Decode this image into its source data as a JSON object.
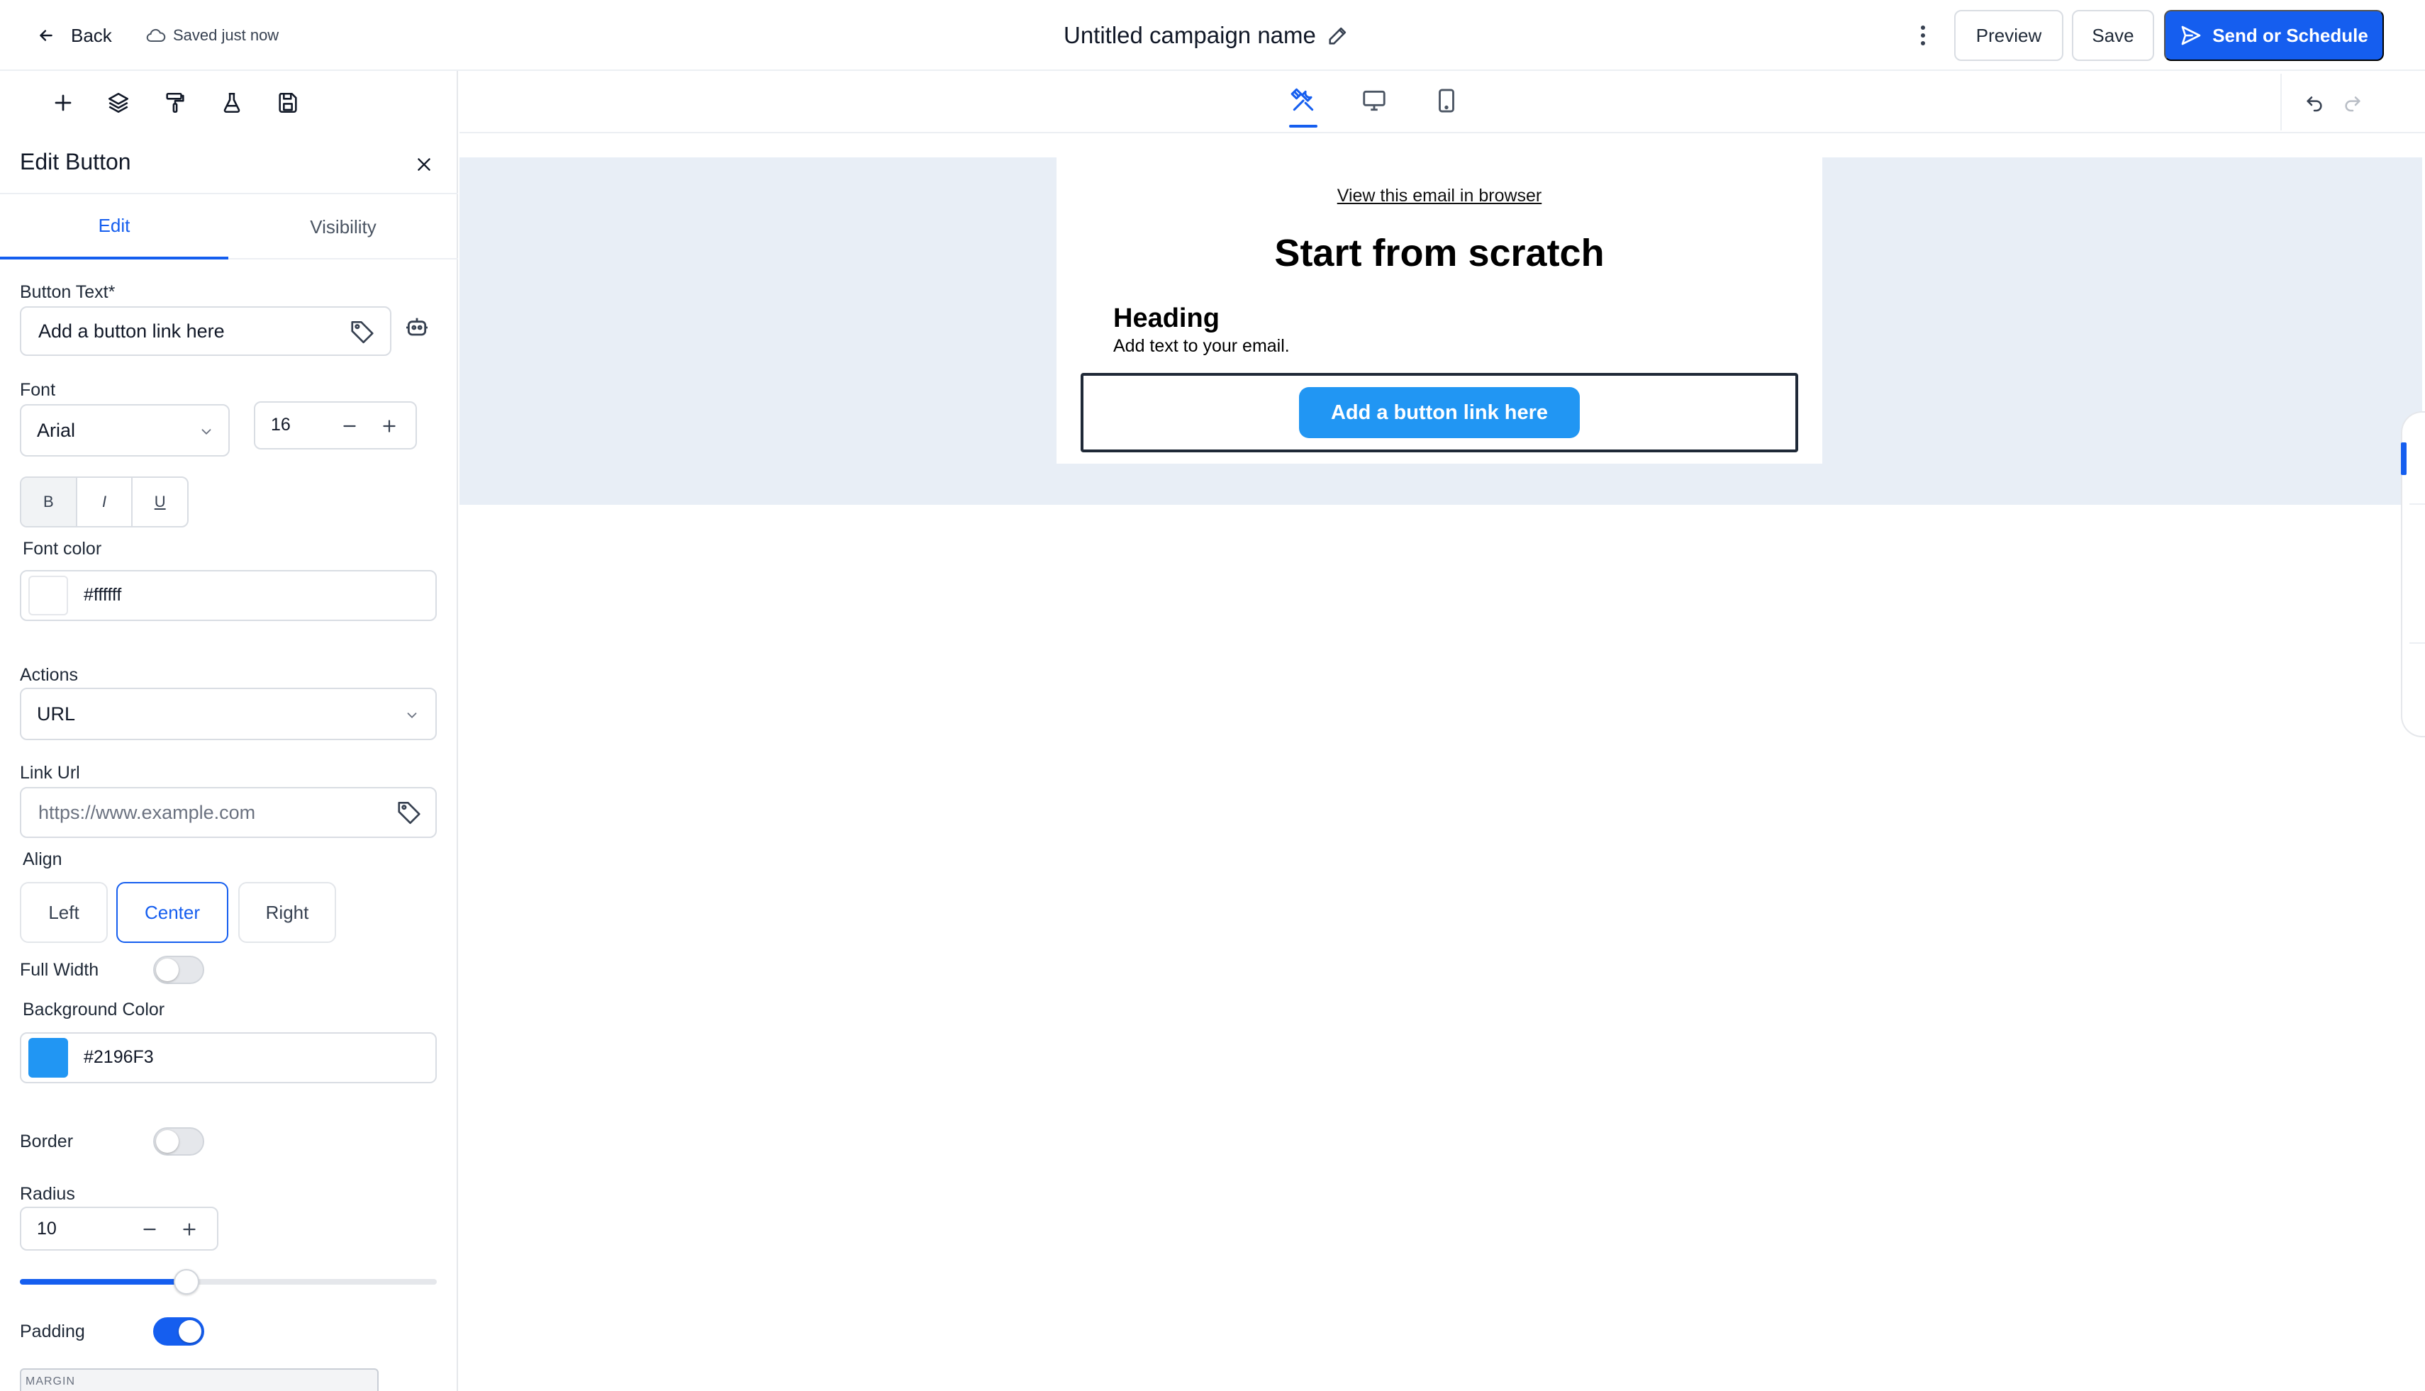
{
  "topbar": {
    "back_label": "Back",
    "saved_label": "Saved just now",
    "campaign_name": "Untitled campaign name",
    "preview_label": "Preview",
    "save_label": "Save",
    "send_label": "Send or Schedule"
  },
  "toolbar": {
    "icons": [
      "plus-icon",
      "layers-icon",
      "paint-roller-icon",
      "flask-icon",
      "save-disk-icon"
    ]
  },
  "panel": {
    "title": "Edit Button",
    "tabs": [
      "Edit",
      "Visibility"
    ],
    "active_tab": "Edit",
    "button_text_label": "Button Text*",
    "button_text_value": "Add a button link here",
    "font_label": "Font",
    "font_value": "Arial",
    "font_size": "16",
    "format_buttons": [
      "B",
      "I",
      "U"
    ],
    "font_color_label": "Font color",
    "font_color_value": "#ffffff",
    "actions_label": "Actions",
    "actions_value": "URL",
    "link_url_label": "Link Url",
    "link_url_placeholder": "https://www.example.com",
    "align_label": "Align",
    "align_options": [
      "Left",
      "Center",
      "Right"
    ],
    "align_selected": "Center",
    "full_width_label": "Full Width",
    "full_width_on": false,
    "background_color_label": "Background Color",
    "background_color_value": "#2196F3",
    "border_label": "Border",
    "border_on": false,
    "radius_label": "Radius",
    "radius_value": "10",
    "radius_slider_fraction": 0.4,
    "padding_label": "Padding",
    "padding_on": true,
    "margin_label": "MARGIN"
  },
  "canvas": {
    "view_modes": [
      "editor-icon",
      "desktop-icon",
      "mobile-icon"
    ],
    "active_view": "editor-icon",
    "email": {
      "browser_link": "View this email in browser",
      "title": "Start from scratch",
      "heading": "Heading",
      "body": "Add text to your email.",
      "button_label": "Add a button link here"
    }
  },
  "colors": {
    "accent": "#155eef",
    "cta": "#2196F3",
    "canvas_bg": "#e8eef6"
  }
}
